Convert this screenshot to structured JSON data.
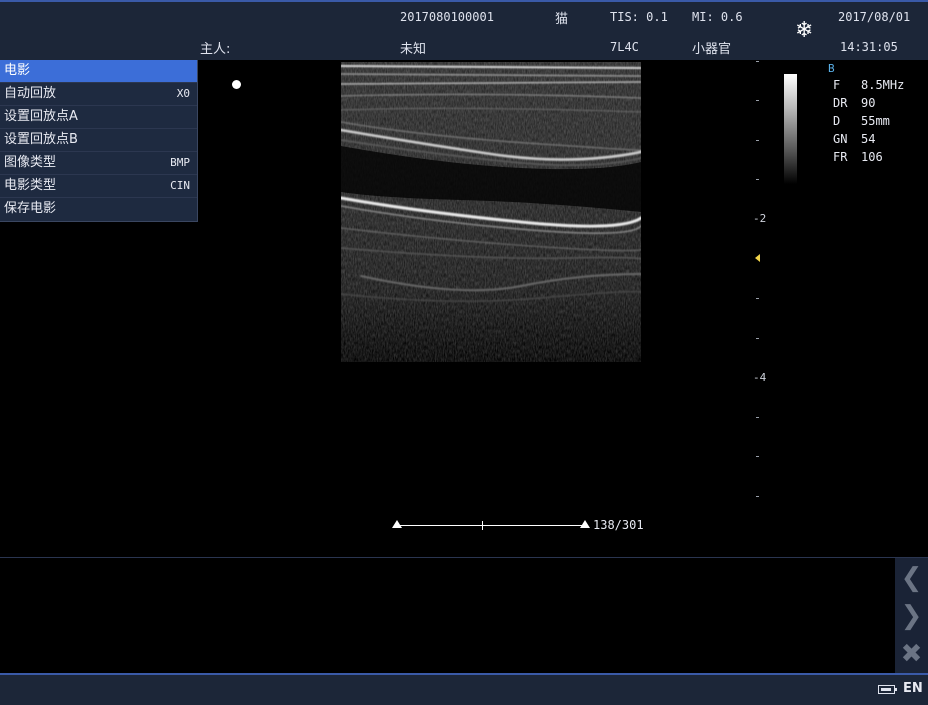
{
  "header": {
    "patient_id": "2017080100001",
    "species": "猫",
    "tis": "TIS: 0.1",
    "mi": "MI: 0.6",
    "date": "2017/08/01",
    "owner_label": "主人:",
    "owner_value": "未知",
    "probe": "7L4C",
    "preset": "小器官",
    "time": "14:31:05",
    "freeze_icon": "snowflake-icon"
  },
  "cine_menu": {
    "title": "电影",
    "items": [
      {
        "label": "自动回放",
        "value": "X0"
      },
      {
        "label": "设置回放点A",
        "value": ""
      },
      {
        "label": "设置回放点B",
        "value": ""
      },
      {
        "label": "图像类型",
        "value": "BMP"
      },
      {
        "label": "电影类型",
        "value": "CIN"
      },
      {
        "label": "保存电影",
        "value": ""
      }
    ]
  },
  "depth_scale": {
    "labels": [
      "-2",
      "-4"
    ]
  },
  "params": {
    "mode": "B",
    "rows": [
      {
        "key": "F",
        "value": "8.5MHz"
      },
      {
        "key": "DR",
        "value": "90"
      },
      {
        "key": "D",
        "value": "55mm"
      },
      {
        "key": "GN",
        "value": "54"
      },
      {
        "key": "FR",
        "value": "106"
      }
    ]
  },
  "cine": {
    "count": "138/301"
  },
  "nav": {
    "prev_icon": "chevron-left-icon",
    "next_icon": "chevron-right-icon",
    "close_icon": "close-icon"
  },
  "footer": {
    "battery_icon": "battery-icon",
    "language": "EN"
  }
}
